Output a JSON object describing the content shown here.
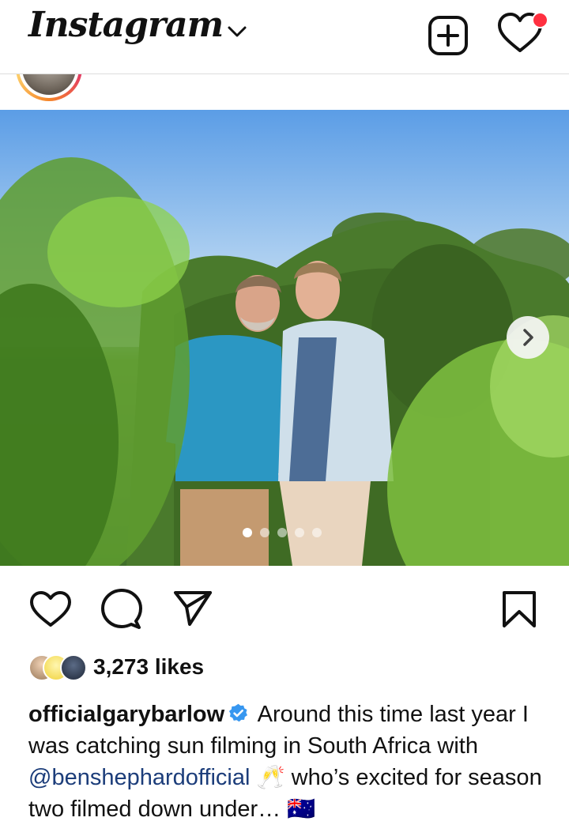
{
  "header": {
    "logo": "Instagram",
    "notification_dot_color": "#ff3040"
  },
  "post": {
    "carousel": {
      "total": 5,
      "current": 1
    },
    "likes_text": "3,273 likes",
    "caption": {
      "username": "officialgarybarlow",
      "text_1": " Around this time last year I was catching sun filming in South Africa with ",
      "mention": "@benshephardofficial",
      "text_2": " 🥂 who’s excited for season two filmed down under… 🇦🇺"
    }
  },
  "icons": {
    "logo_chevron": "chevron-down-icon",
    "new_post": "plus-square-icon",
    "activity": "heart-icon",
    "like": "heart-outline-icon",
    "comment": "comment-bubble-icon",
    "share": "paper-plane-icon",
    "save": "bookmark-icon",
    "verified": "verified-badge-icon"
  },
  "colors": {
    "verified": "#3797f0",
    "mention": "#1c3d7a"
  }
}
